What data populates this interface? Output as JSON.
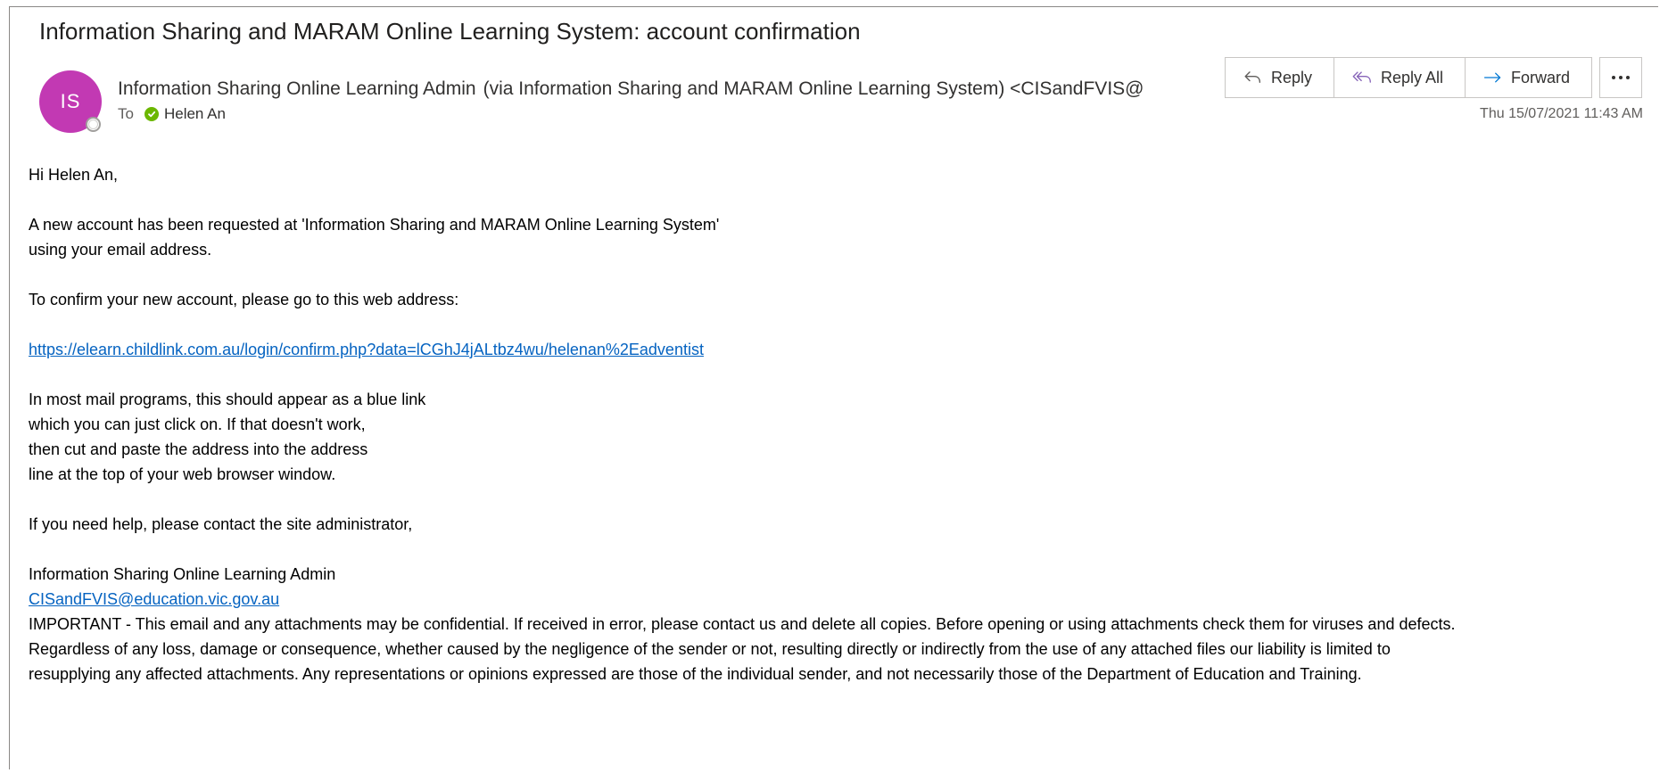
{
  "email": {
    "subject": "Information Sharing and MARAM Online Learning System: account confirmation",
    "sender": {
      "initials": "IS",
      "name": "Information Sharing Online Learning Admin",
      "via": "(via Information Sharing and MARAM Online Learning System) <CISandFVIS@",
      "avatar_color": "#c239b3"
    },
    "to_label": "To",
    "recipient": "Helen An",
    "timestamp": "Thu 15/07/2021 11:43 AM"
  },
  "toolbar": {
    "reply_label": "Reply",
    "reply_all_label": "Reply All",
    "forward_label": "Forward",
    "more_icon": "ellipsis-icon"
  },
  "body": {
    "greeting": "Hi Helen An,",
    "para1_line1": "A new account has been requested at 'Information Sharing and MARAM Online Learning System'",
    "para1_line2": "using your email address.",
    "para2": "To confirm your new account, please go to this web address:",
    "link": "https://elearn.childlink.com.au/login/confirm.php?data=lCGhJ4jALtbz4wu/helenan%2Eadventist",
    "para3_line1": "In most mail programs, this should appear as a blue link",
    "para3_line2": "which you can just click on. If that doesn't work,",
    "para3_line3": "then cut and paste the address into the address",
    "para3_line4": "line at the top of your web browser window.",
    "para4": "If you need help, please contact the site administrator,",
    "signature_name": "Information Sharing Online Learning Admin",
    "signature_email": "CISandFVIS@education.vic.gov.au",
    "disclaimer_line1": "IMPORTANT - This email and any attachments may be confidential. If received in error, please contact us and delete all copies. Before opening or using attachments check them for viruses and defects.",
    "disclaimer_line2": "Regardless of any loss, damage or consequence, whether caused by the negligence of the sender or not, resulting directly or indirectly from the use of any attached files our liability is limited to",
    "disclaimer_line3": "resupplying any affected attachments. Any representations or opinions expressed are those of the individual sender, and not necessarily those of the Department of Education and Training."
  },
  "colors": {
    "link": "#0563c1",
    "accent": "#0078d4",
    "presence_ok": "#6bb700"
  }
}
